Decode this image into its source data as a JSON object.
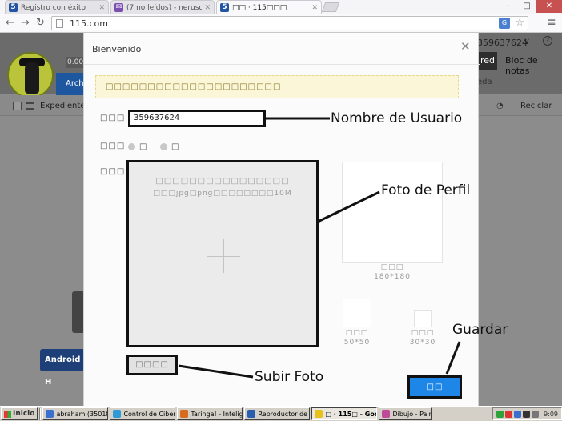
{
  "browser": {
    "tabs": [
      {
        "title": "Registro con éxito",
        "favicon": "115-logo-icon",
        "active": false
      },
      {
        "title": "(7 no leídos) - nerusonkun - ",
        "favicon": "mail-icon",
        "active": false
      },
      {
        "title": "□□ · 115□□□",
        "favicon": "115-logo-icon",
        "active": true
      }
    ],
    "url": "115.com",
    "translate_icon_label": "G",
    "window_controls": {
      "min": "–",
      "max": "□",
      "close": "✕"
    }
  },
  "page": {
    "user_id": "359637624",
    "counter": "0.00E",
    "archive_tab": "Archi",
    "red_tab": "red",
    "notes_tab": "Bloc de notas",
    "search_hint": "eda",
    "expediente": "Expediente",
    "reciclar": "Reciclar",
    "android_button": "Android H"
  },
  "modal": {
    "title": "Bienvenido",
    "notice": "□□□□□□□□□□□□□□□□□□□□□",
    "username_label": "□□□",
    "username_value": "359637624",
    "gender_label": "□□□",
    "gender_options": [
      "□",
      "□"
    ],
    "photo_label": "□□□",
    "photo_hint_1": "□□□□□□□□□□□□□□□□",
    "photo_hint_2": "□□□jpg□png□□□□□□□□10M",
    "preview_large_label": "□□□",
    "preview_large_size": "180*180",
    "preview_medium_label": "□□□",
    "preview_medium_size": "50*50",
    "preview_small_label": "□□□",
    "preview_small_size": "30*30",
    "upload_button": "□□□□",
    "save_button": "□□"
  },
  "annotations": {
    "username": "Nombre de Usuario",
    "photo": "Foto de Perfil",
    "save": "Guardar",
    "upload": "Subir Foto"
  },
  "taskbar": {
    "start": "Inicio",
    "items": [
      {
        "label": "abraham (35018...",
        "color": "#3a6fd0"
      },
      {
        "label": "Control de Ciber ...",
        "color": "#2e9bd6"
      },
      {
        "label": "Taringa! - Intelig...",
        "color": "#d96a1e"
      },
      {
        "label": "Reproductor de ...",
        "color": "#2a5fb0"
      },
      {
        "label": "□ · 115□ - Goo...",
        "color": "#e8c21a",
        "active": true
      },
      {
        "label": "Dibujo - Paint",
        "color": "#c04a9a"
      }
    ],
    "clock": "9:09"
  }
}
